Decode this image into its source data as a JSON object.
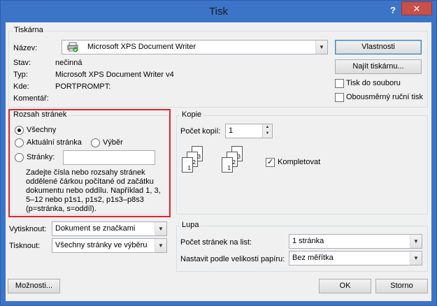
{
  "window": {
    "title": "Tisk",
    "help": "?",
    "close": "✕"
  },
  "printer": {
    "group": "Tiskárna",
    "name_label": "Název:",
    "name_value": "Microsoft XPS Document Writer",
    "status_label": "Stav:",
    "status_value": "nečinná",
    "type_label": "Typ:",
    "type_value": "Microsoft XPS Document Writer v4",
    "where_label": "Kde:",
    "where_value": "PORTPROMPT:",
    "comment_label": "Komentář:",
    "properties_btn": "Vlastnosti",
    "find_btn": "Najít tiskárnu...",
    "print_to_file": "Tisk do souboru",
    "duplex": "Obousměrný ruční tisk"
  },
  "range": {
    "group": "Rozsah stránek",
    "all": "Všechny",
    "current": "Aktuální stránka",
    "selection": "Výběr",
    "pages": "Stránky:",
    "hint1": "Zadejte čísla nebo rozsahy stránek",
    "hint2": "oddělené čárkou počítané od začátku",
    "hint3": "dokumentu nebo oddílu. Například 1, 3,",
    "hint4": "5–12 nebo p1s1, p1s2, p1s3–p8s3",
    "hint5": "(p=stránka, s=oddíl)."
  },
  "copies": {
    "group": "Kopie",
    "count_label": "Počet kopií:",
    "count_value": "1",
    "collate": "Kompletovat",
    "pages": [
      "1",
      "2",
      "3"
    ]
  },
  "print_what": {
    "label": "Vytisknout:",
    "value": "Dokument se značkami"
  },
  "print": {
    "label": "Tisknout:",
    "value": "Všechny stránky ve výběru"
  },
  "zoom": {
    "group": "Lupa",
    "per_sheet_label": "Počet stránek na list:",
    "per_sheet_value": "1 stránka",
    "scale_label": "Nastavit podle velikosti papíru:",
    "scale_value": "Bez měřítka"
  },
  "footer": {
    "options": "Možnosti...",
    "ok": "OK",
    "cancel": "Storno"
  }
}
